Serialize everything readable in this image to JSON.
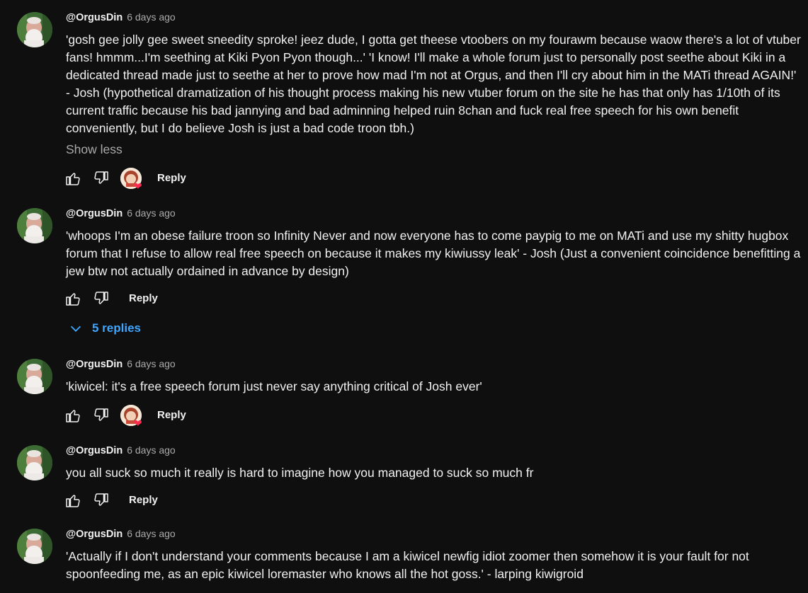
{
  "comments": [
    {
      "author": "@OrgusDin",
      "time": "6 days ago",
      "text": "'gosh gee jolly gee sweet sneedity sproke! jeez dude, I gotta get theese vtoobers on my fourawm because waow there's a lot of vtuber fans! hmmm...I'm seething at Kiki Pyon Pyon though...' 'I know! I'll make a whole forum just to personally post seethe about Kiki in a dedicated thread made just to seethe at her to prove how mad I'm not at Orgus, and then I'll cry about him in the MATi thread AGAIN!' - Josh (hypothetical dramatization of his thought process making his new vtuber forum on the site he has that only has 1/10th of its current traffic because his bad jannying and bad adminning helped ruin 8chan and fuck real free speech for his own benefit conveniently, but I do believe Josh is just a bad code troon tbh.)",
      "show_less": "Show less",
      "reply": "Reply",
      "creator_heart": true
    },
    {
      "author": "@OrgusDin",
      "time": "6 days ago",
      "text": "'whoops I'm an obese failure troon so Infinity Never and now everyone has to come paypig to me on MATi and use my shitty hugbox forum that I refuse to allow real free speech on because it makes my kiwiussy leak' - Josh (Just a convenient coincidence benefitting a jew btw not actually ordained in advance by design)",
      "reply": "Reply",
      "replies": "5 replies",
      "creator_heart": false
    },
    {
      "author": "@OrgusDin",
      "time": "6 days ago",
      "text": "'kiwicel: it's a free speech forum just never say anything critical of Josh ever'",
      "reply": "Reply",
      "creator_heart": true
    },
    {
      "author": "@OrgusDin",
      "time": "6 days ago",
      "text": "you all suck so much it really is hard to imagine how you managed to suck so much fr",
      "reply": "Reply",
      "creator_heart": false
    },
    {
      "author": "@OrgusDin",
      "time": "6 days ago",
      "text": "'Actually if I don't understand your comments because I am a kiwicel newfig idiot zoomer then somehow it is your fault for not spoonfeeding me, as an epic kiwicel loremaster who knows all the hot goss.' - larping kiwigroid",
      "creator_heart": false
    }
  ],
  "icons": {
    "like": "thumb-up-icon",
    "dislike": "thumb-down-icon",
    "expand": "chevron-down-icon",
    "heart": "heart-icon"
  },
  "colors": {
    "background": "#0f0f0f",
    "text": "#f1f1f1",
    "muted": "#aaaaaa",
    "link": "#3ea6ff",
    "heart": "#ff2a4d"
  }
}
